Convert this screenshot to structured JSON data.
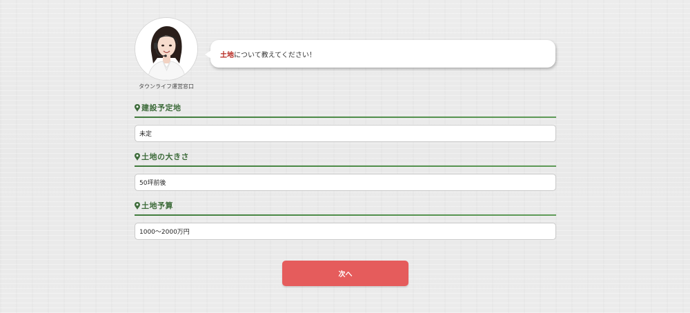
{
  "operator": {
    "name": "タウンライフ運営窓口",
    "avatar_icon": "operator-avatar-icon"
  },
  "bubble": {
    "accent": "土地",
    "text": "について教えてください！",
    "accent_color": "#b5261e"
  },
  "sections": [
    {
      "title": "建設予定地",
      "value": "未定",
      "icon": "pin-icon"
    },
    {
      "title": "土地の大きさ",
      "value": "50坪前後",
      "icon": "pin-icon"
    },
    {
      "title": "土地予算",
      "value": "1000～2000万円",
      "icon": "pin-icon"
    }
  ],
  "next_button": {
    "label": "次へ",
    "color": "#e55c5c"
  },
  "colors": {
    "section_title": "#3d6b3a",
    "rule": "#3f7a3b"
  }
}
